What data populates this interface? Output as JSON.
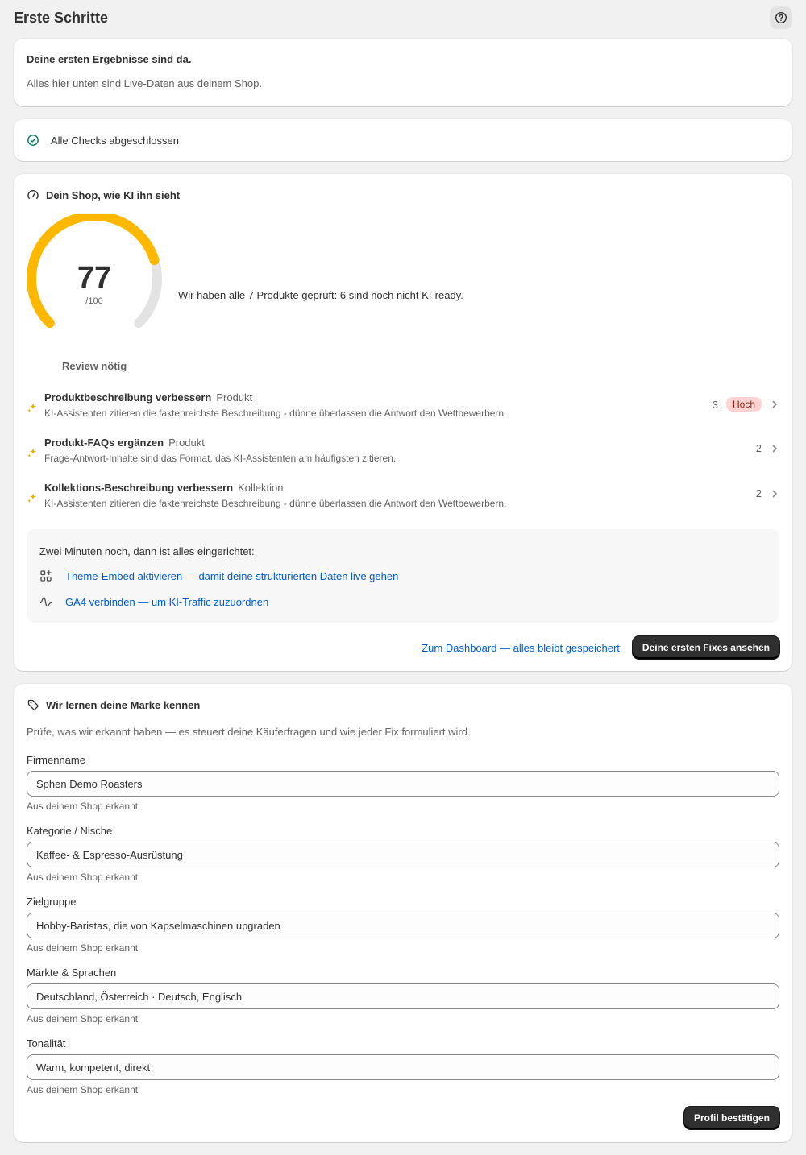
{
  "page": {
    "title": "Erste Schritte",
    "help_icon": "question-circle-icon"
  },
  "results_banner": {
    "title": "Deine ersten Ergebnisse sind da.",
    "subtitle": "Alles hier unten sind Live-Daten aus deinem Shop."
  },
  "checks": {
    "icon": "check-circle-icon",
    "label": "Alle Checks abgeschlossen",
    "icon_color": "#0c7a5b"
  },
  "ai_view": {
    "icon": "gauge-icon",
    "title": "Dein Shop, wie KI ihn sieht",
    "score": "77",
    "score_max": "/100",
    "score_fraction": 0.77,
    "gauge_color": "#ffb800",
    "track_color": "#e3e3e3",
    "summary": "Wir haben alle 7 Produkte geprüft: 6 sind noch nicht KI-ready.",
    "review_label": "Review nötig",
    "fixes": [
      {
        "title": "Produktbeschreibung verbessern",
        "scope": "Produkt",
        "description": "KI-Assistenten zitieren die faktenreichste Beschreibung - dünne überlassen die Antwort den Wettbewerbern.",
        "count": "3",
        "badge": "Hoch"
      },
      {
        "title": "Produkt-FAQs ergänzen",
        "scope": "Produkt",
        "description": "Frage-Antwort-Inhalte sind das Format, das KI-Assistenten am häufigsten zitieren.",
        "count": "2",
        "badge": ""
      },
      {
        "title": "Kollektions-Beschreibung verbessern",
        "scope": "Kollektion",
        "description": "KI-Assistenten zitieren die faktenreichste Beschreibung - dünne überlassen die Antwort den Wettbewerbern.",
        "count": "2",
        "badge": ""
      }
    ],
    "setup": {
      "intro": "Zwei Minuten noch, dann ist alles eingerichtet:",
      "links": [
        {
          "icon": "apps-add-icon",
          "label": "Theme-Embed aktivieren — damit deine strukturierten Daten live gehen"
        },
        {
          "icon": "analytics-wave-icon",
          "label": "GA4 verbinden — um KI-Traffic zuzuordnen"
        }
      ]
    },
    "dashboard_link": "Zum Dashboard — alles bleibt gespeichert",
    "primary_button": "Deine ersten Fixes ansehen"
  },
  "brand": {
    "icon": "tag-icon",
    "title": "Wir lernen deine Marke kennen",
    "intro": "Prüfe, was wir erkannt haben — es steuert deine Käuferfragen und wie jeder Fix formuliert wird.",
    "fields": [
      {
        "label": "Firmenname",
        "value": "Sphen Demo Roasters",
        "hint": "Aus deinem Shop erkannt"
      },
      {
        "label": "Kategorie / Nische",
        "value": "Kaffee- & Espresso-Ausrüstung",
        "hint": "Aus deinem Shop erkannt"
      },
      {
        "label": "Zielgruppe",
        "value": "Hobby-Baristas, die von Kapselmaschinen upgraden",
        "hint": "Aus deinem Shop erkannt"
      },
      {
        "label": "Märkte & Sprachen",
        "value": "Deutschland, Österreich · Deutsch, Englisch",
        "hint": "Aus deinem Shop erkannt"
      },
      {
        "label": "Tonalität",
        "value": "Warm, kompetent, direkt",
        "hint": "Aus deinem Shop erkannt"
      }
    ],
    "confirm_button": "Profil bestätigen"
  }
}
